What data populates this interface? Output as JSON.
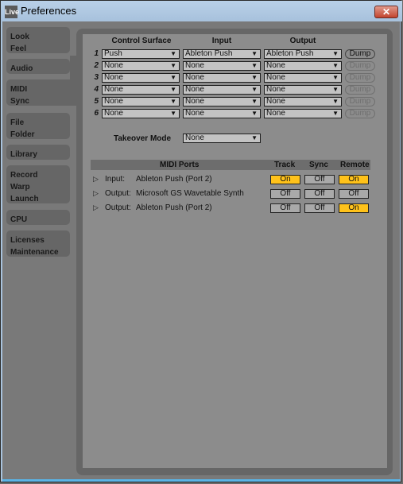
{
  "window": {
    "app_icon": "Live",
    "title": "Preferences",
    "close_glyph": "✕"
  },
  "tabs": [
    {
      "lines": [
        "Look",
        "Feel"
      ],
      "selected": false
    },
    {
      "lines": [
        "Audio"
      ],
      "selected": false
    },
    {
      "lines": [
        "MIDI",
        "Sync"
      ],
      "selected": true
    },
    {
      "lines": [
        "File",
        "Folder"
      ],
      "selected": false
    },
    {
      "lines": [
        "Library"
      ],
      "selected": false
    },
    {
      "lines": [
        "Record",
        "Warp",
        "Launch"
      ],
      "selected": false
    },
    {
      "lines": [
        "CPU"
      ],
      "selected": false
    },
    {
      "lines": [
        "Licenses",
        "Maintenance"
      ],
      "selected": false
    }
  ],
  "control_surfaces": {
    "headers": {
      "control_surface": "Control Surface",
      "input": "Input",
      "output": "Output"
    },
    "dump_label": "Dump",
    "rows": [
      {
        "num": "1",
        "surface": "Push",
        "input": "Ableton Push",
        "output": "Ableton Push",
        "dump_enabled": true
      },
      {
        "num": "2",
        "surface": "None",
        "input": "None",
        "output": "None",
        "dump_enabled": false
      },
      {
        "num": "3",
        "surface": "None",
        "input": "None",
        "output": "None",
        "dump_enabled": false
      },
      {
        "num": "4",
        "surface": "None",
        "input": "None",
        "output": "None",
        "dump_enabled": false
      },
      {
        "num": "5",
        "surface": "None",
        "input": "None",
        "output": "None",
        "dump_enabled": false
      },
      {
        "num": "6",
        "surface": "None",
        "input": "None",
        "output": "None",
        "dump_enabled": false
      }
    ]
  },
  "takeover": {
    "label": "Takeover Mode",
    "value": "None"
  },
  "midi_ports": {
    "headers": {
      "ports": "MIDI Ports",
      "track": "Track",
      "sync": "Sync",
      "remote": "Remote"
    },
    "rows": [
      {
        "kind": "Input:",
        "name": "Ableton Push (Port 2)",
        "track": "On",
        "sync": "Off",
        "remote": "On"
      },
      {
        "kind": "Output:",
        "name": "Microsoft GS Wavetable Synth",
        "track": "Off",
        "sync": "Off",
        "remote": "Off"
      },
      {
        "kind": "Output:",
        "name": "Ableton Push (Port 2)",
        "track": "Off",
        "sync": "Off",
        "remote": "On"
      }
    ]
  },
  "colors": {
    "on": "#ffc21a",
    "off": "#a9a9a9"
  },
  "icons": {
    "dropdown": "▼",
    "expand": "▷"
  }
}
